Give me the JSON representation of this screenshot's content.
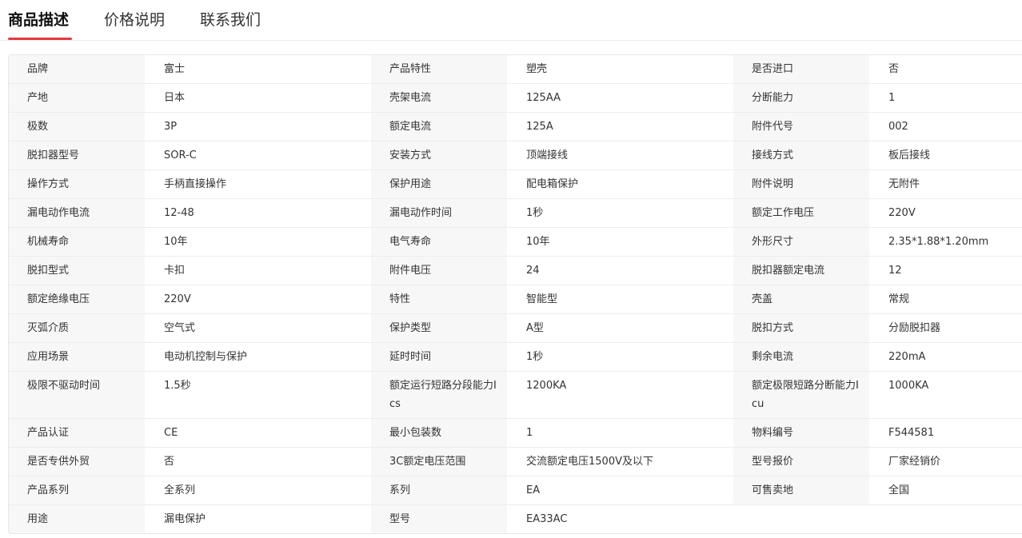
{
  "tabs": [
    {
      "label": "商品描述",
      "active": true
    },
    {
      "label": "价格说明",
      "active": false
    },
    {
      "label": "联系我们",
      "active": false
    }
  ],
  "accent_color": "#e4393c",
  "spec_rows": [
    [
      [
        "品牌",
        "富士"
      ],
      [
        "产品特性",
        "塑壳"
      ],
      [
        "是否进口",
        "否"
      ]
    ],
    [
      [
        "产地",
        "日本"
      ],
      [
        "壳架电流",
        "125AA"
      ],
      [
        "分断能力",
        "1"
      ]
    ],
    [
      [
        "极数",
        "3P"
      ],
      [
        "额定电流",
        "125A"
      ],
      [
        "附件代号",
        "002"
      ]
    ],
    [
      [
        "脱扣器型号",
        "SOR-C"
      ],
      [
        "安装方式",
        "顶端接线"
      ],
      [
        "接线方式",
        "板后接线"
      ]
    ],
    [
      [
        "操作方式",
        "手柄直接操作"
      ],
      [
        "保护用途",
        "配电箱保护"
      ],
      [
        "附件说明",
        "无附件"
      ]
    ],
    [
      [
        "漏电动作电流",
        "12-48"
      ],
      [
        "漏电动作时间",
        "1秒"
      ],
      [
        "额定工作电压",
        "220V"
      ]
    ],
    [
      [
        "机械寿命",
        "10年"
      ],
      [
        "电气寿命",
        "10年"
      ],
      [
        "外形尺寸",
        "2.35*1.88*1.20mm"
      ]
    ],
    [
      [
        "脱扣型式",
        "卡扣"
      ],
      [
        "附件电压",
        "24"
      ],
      [
        "脱扣器额定电流",
        "12"
      ]
    ],
    [
      [
        "额定绝缘电压",
        "220V"
      ],
      [
        "特性",
        "智能型"
      ],
      [
        "壳盖",
        "常规"
      ]
    ],
    [
      [
        "灭弧介质",
        "空气式"
      ],
      [
        "保护类型",
        "A型"
      ],
      [
        "脱扣方式",
        "分励脱扣器"
      ]
    ],
    [
      [
        "应用场景",
        "电动机控制与保护"
      ],
      [
        "延时时间",
        "1秒"
      ],
      [
        "剩余电流",
        "220mA"
      ]
    ],
    [
      [
        "极限不驱动时间",
        "1.5秒"
      ],
      [
        "额定运行短路分段能力Ics",
        "1200KA"
      ],
      [
        "额定极限短路分断能力Icu",
        "1000KA"
      ]
    ],
    [
      [
        "产品认证",
        "CE"
      ],
      [
        "最小包装数",
        "1"
      ],
      [
        "物料编号",
        "F544581"
      ]
    ],
    [
      [
        "是否专供外贸",
        "否"
      ],
      [
        "3C额定电压范围",
        "交流额定电压1500V及以下"
      ],
      [
        "型号报价",
        "厂家经销价"
      ]
    ],
    [
      [
        "产品系列",
        "全系列"
      ],
      [
        "系列",
        "EA"
      ],
      [
        "可售卖地",
        "全国"
      ]
    ],
    [
      [
        "用途",
        "漏电保护"
      ],
      [
        "型号",
        "EA33AC"
      ],
      [
        "",
        ""
      ]
    ]
  ]
}
